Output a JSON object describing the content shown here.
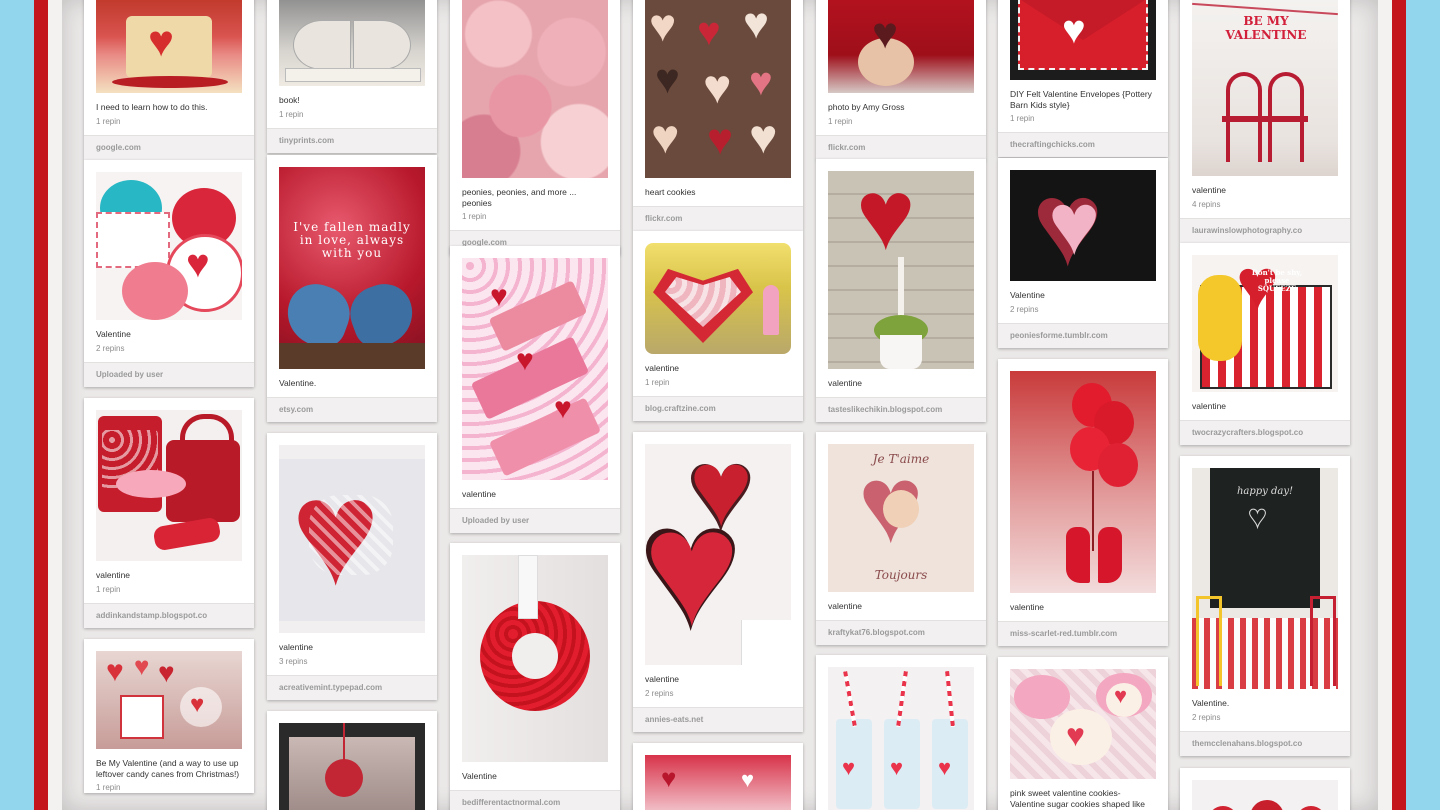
{
  "colors": {
    "frame_blue": "#92d6ee",
    "frame_red": "#c4141c",
    "board_bg": "#ebe8e8",
    "card_bg": "#ffffff",
    "source_bar_bg": "#f2f0f0"
  },
  "columns": [
    {
      "pins": [
        {
          "description": "I need to learn how to do this.",
          "repins": "1 repin",
          "source": "google.com",
          "image": "heart-cake-slice"
        },
        {
          "description": "Valentine",
          "repins": "2 repins",
          "source": "Uploaded by user",
          "image": "sweet-sugar-belle-cookies"
        },
        {
          "description": "valentine",
          "repins": "1 repin",
          "source": "addinkandstamp.blogspot.co",
          "image": "paint-can-and-purse-gifts"
        },
        {
          "description": "Be My Valentine (and a way to use up leftover candy canes from Christmas!)",
          "repins": "1 repin",
          "source": "",
          "image": "candy-cane-hearts"
        }
      ]
    },
    {
      "pins": [
        {
          "description": "book!",
          "repins": "1 repin",
          "source": "tinyprints.com",
          "image": "heart-book-pages"
        },
        {
          "description": "Valentine.",
          "repins": "",
          "source": "etsy.com",
          "image": "love-birds-painting",
          "overlay_text": "I've fallen madly in love, always with you"
        },
        {
          "description": "valentine",
          "repins": "3 repins",
          "source": "acreativemint.typepad.com",
          "image": "gingham-heart-wreath"
        },
        {
          "description": "",
          "repins": "",
          "source": "",
          "image": "mirror-heart-ornament"
        }
      ]
    },
    {
      "pins": [
        {
          "description": "peonies, peonies, and more ... peonies",
          "repins": "1 repin",
          "source": "google.com",
          "image": "pink-peonies"
        },
        {
          "description": "valentine",
          "repins": "",
          "source": "Uploaded by user",
          "image": "strawberry-bars"
        },
        {
          "description": "Valentine",
          "repins": "",
          "source": "bedifferentactnormal.com",
          "image": "red-paper-rose-wreath"
        }
      ]
    },
    {
      "pins": [
        {
          "description": "heart cookies",
          "repins": "",
          "source": "flickr.com",
          "image": "lace-heart-cookies"
        },
        {
          "description": "valentine",
          "repins": "1 repin",
          "source": "blog.craftzine.com",
          "image": "heart-box-cupcakes"
        },
        {
          "description": "valentine",
          "repins": "2 repins",
          "source": "annies-eats.net",
          "image": "red-heart-cookies"
        },
        {
          "description": "",
          "repins": "",
          "source": "",
          "image": "pink-party-table"
        }
      ]
    },
    {
      "pins": [
        {
          "description": "photo by Amy Gross",
          "repins": "1 repin",
          "source": "flickr.com",
          "image": "heart-ornament-hands"
        },
        {
          "description": "valentine",
          "repins": "",
          "source": "tasteslikechikin.blogspot.com",
          "image": "rose-heart-topiary"
        },
        {
          "description": "valentine",
          "repins": "",
          "source": "kraftykat76.blogspot.com",
          "image": "je-taime-cherub",
          "overlay_text_top": "Je T'aime",
          "overlay_text_bottom": "Toujours"
        },
        {
          "description": "",
          "repins": "",
          "source": "",
          "image": "striped-straw-milk-bottles"
        }
      ]
    },
    {
      "pins": [
        {
          "description": "DIY Felt Valentine Envelopes {Pottery Barn Kids style}",
          "repins": "1 repin",
          "source": "thecraftingchicks.com",
          "image": "felt-envelope"
        },
        {
          "description": "Valentine",
          "repins": "2 repins",
          "source": "peoniesforme.tumblr.com",
          "image": "cupcake-heart-cake"
        },
        {
          "description": "valentine",
          "repins": "",
          "source": "miss-scarlet-red.tumblr.com",
          "image": "red-heels-balloons"
        },
        {
          "description": "pink sweet valentine cookies- Valentine sugar cookies shaped like candy lollies",
          "repins": "",
          "source": "",
          "image": "pink-heart-cookies"
        }
      ]
    },
    {
      "pins": [
        {
          "description": "valentine",
          "repins": "4 repins",
          "source": "laurawinslowphotography.co",
          "image": "be-my-valentine-chairs",
          "overlay_text": "BE MY VALENTINE"
        },
        {
          "description": "valentine",
          "repins": "",
          "source": "twocrazycrafters.blogspot.co",
          "image": "vintage-accordion-card",
          "overlay_text": "Don't be shy, please SQUEEZE"
        },
        {
          "description": "Valentine.",
          "repins": "2 repins",
          "source": "themcclenahans.blogspot.co",
          "image": "chalkboard-party",
          "overlay_text": "happy day!"
        },
        {
          "description": "",
          "repins": "",
          "source": "",
          "image": "red-pom-poms"
        }
      ]
    }
  ]
}
